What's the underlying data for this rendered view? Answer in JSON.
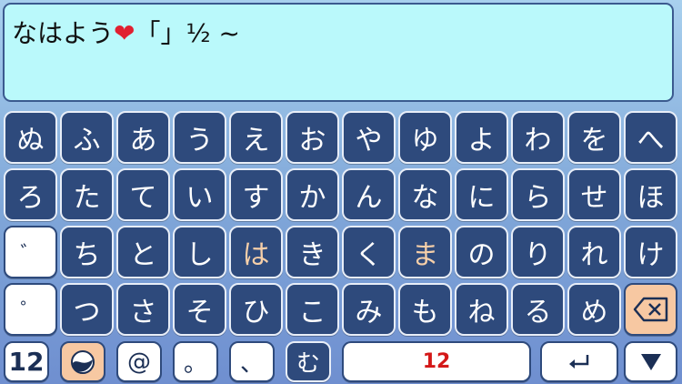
{
  "input": {
    "text_kana": "なはよう",
    "heart": "❤",
    "text_rest": "「」½ ~"
  },
  "keys": {
    "row1": [
      "ぬ",
      "ふ",
      "あ",
      "う",
      "え",
      "お",
      "や",
      "ゆ",
      "よ",
      "わ",
      "を",
      "へ"
    ],
    "row2": [
      "ろ",
      "た",
      "て",
      "い",
      "す",
      "か",
      "ん",
      "な",
      "に",
      "ら",
      "せ",
      "ほ"
    ],
    "row3": [
      "゛",
      "ち",
      "と",
      "し",
      "は",
      "き",
      "く",
      "ま",
      "の",
      "り",
      "れ",
      "け"
    ],
    "row4": [
      "゜",
      "つ",
      "さ",
      "そ",
      "ひ",
      "こ",
      "み",
      "も",
      "ね",
      "る",
      "め"
    ],
    "bottom": {
      "num": "12",
      "at": "@",
      "period": "。",
      "comma": "、",
      "mu": "む",
      "space": "12"
    }
  },
  "icons": {
    "backspace": "backspace-icon",
    "enter": "enter-icon",
    "down": "triangle-down-icon",
    "globe": "globe-icon"
  },
  "colors": {
    "key_bg": "#2e4a7c",
    "textarea_bg": "#baf9fb",
    "highlight": "#f6cfa9",
    "space_text": "#d41818"
  }
}
